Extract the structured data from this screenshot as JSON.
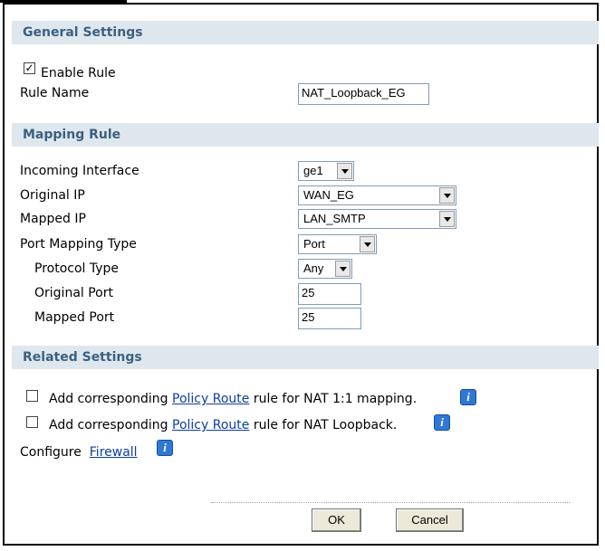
{
  "sections": {
    "general": "General Settings",
    "mapping": "Mapping Rule",
    "related": "Related Settings"
  },
  "general": {
    "enable_rule_label": "Enable Rule",
    "enable_rule_checked": true,
    "rule_name_label": "Rule Name",
    "rule_name_value": "NAT_Loopback_EG"
  },
  "mapping": {
    "incoming_interface_label": "Incoming Interface",
    "incoming_interface_value": "ge1",
    "original_ip_label": "Original IP",
    "original_ip_value": "WAN_EG",
    "mapped_ip_label": "Mapped IP",
    "mapped_ip_value": "LAN_SMTP",
    "port_mapping_type_label": "Port Mapping Type",
    "port_mapping_type_value": "Port",
    "protocol_type_label": "Protocol Type",
    "protocol_type_value": "Any",
    "original_port_label": "Original Port",
    "original_port_value": "25",
    "mapped_port_label": "Mapped Port",
    "mapped_port_value": "25"
  },
  "related": {
    "row1_prefix": "Add corresponding ",
    "row1_link": "Policy Route",
    "row1_suffix": " rule for NAT 1:1 mapping.",
    "row2_prefix": "Add corresponding ",
    "row2_link": "Policy Route",
    "row2_suffix": " rule for NAT Loopback.",
    "configure_label": "Configure",
    "firewall_link": "Firewall"
  },
  "buttons": {
    "ok": "OK",
    "cancel": "Cancel"
  },
  "icons": {
    "info": "info-icon"
  }
}
